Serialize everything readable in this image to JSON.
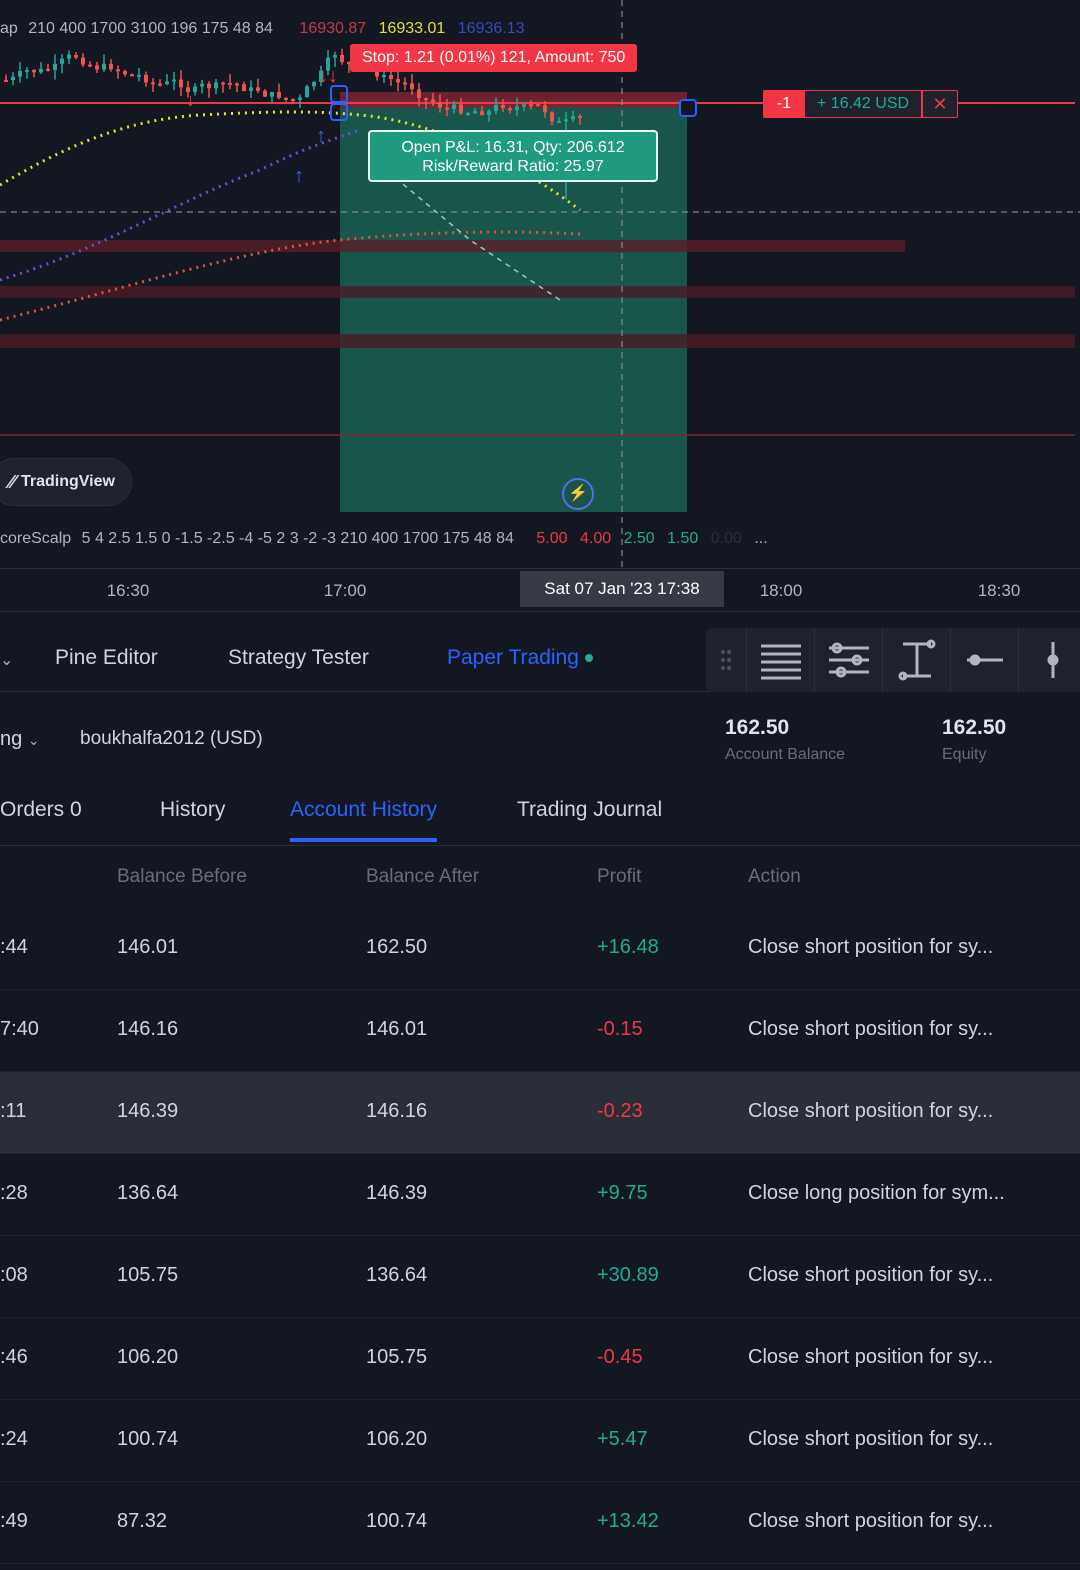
{
  "chart": {
    "top_indicator": [
      "ap",
      "210 400 1700 3100 196 175 48 84"
    ],
    "top_prices": [
      "16930.87",
      "16933.01",
      "16936.13"
    ],
    "stop_label": "Stop: 1.21 (0.01%) 121, Amount: 750",
    "pnl_line1": "Open P&L: 16.31, Qty: 206.612",
    "pnl_line2": "Risk/Reward Ratio: 25.97",
    "position": {
      "qty": "-1",
      "pnl": "+ 16.42 USD",
      "close": "✕"
    },
    "logo": "TradingView",
    "bottom_indicator_name": "coreScalp",
    "bottom_indicator_params": "5 4 2.5 1.5 0 -1.5 -2.5 -4 -5 2 3 -2 -3 210 400 1700 175 48 84",
    "bottom_values": [
      "5.00",
      "4.00",
      "2.50",
      "1.50",
      "0.00",
      "..."
    ],
    "colors": {
      "green": "#22ab94",
      "red": "#f23645",
      "blue": "#2962ff",
      "yellow": "#ffeb3b"
    }
  },
  "time_axis": {
    "ticks": [
      "16:30",
      "17:00",
      "18:00",
      "18:30"
    ],
    "crosshair": "Sat 07 Jan '23   17:38"
  },
  "panel": {
    "tabs": [
      "Pine Editor",
      "Strategy Tester",
      "Paper Trading"
    ],
    "active_tab": "Paper Trading",
    "toolbar_icons": [
      "drag-handle-icon",
      "align-lines-icon",
      "adjust-lines-icon",
      "text-cursor-icon",
      "horizontal-line-icon",
      "vertical-line-icon"
    ],
    "account_selector": "ng",
    "account_name": "boukhalfa2012 (USD)",
    "account_balance": {
      "value": "162.50",
      "label": "Account Balance"
    },
    "equity": {
      "value": "162.50",
      "label": "Equity"
    },
    "sub_tabs": [
      "Orders  0",
      "History",
      "Account History",
      "Trading Journal"
    ],
    "active_sub_tab": "Account History"
  },
  "table": {
    "headers": [
      "Balance Before",
      "Balance After",
      "Profit",
      "Action"
    ],
    "rows": [
      {
        "time": ":44",
        "before": "146.01",
        "after": "162.50",
        "profit": "+16.48",
        "action": "Close short position for sy...",
        "sign": "pos"
      },
      {
        "time": "7:40",
        "before": "146.16",
        "after": "146.01",
        "profit": "-0.15",
        "action": "Close short position for sy...",
        "sign": "neg"
      },
      {
        "time": ":11",
        "before": "146.39",
        "after": "146.16",
        "profit": "-0.23",
        "action": "Close short position for sy...",
        "sign": "neg",
        "highlight": true
      },
      {
        "time": ":28",
        "before": "136.64",
        "after": "146.39",
        "profit": "+9.75",
        "action": "Close long position for sym...",
        "sign": "pos"
      },
      {
        "time": ":08",
        "before": "105.75",
        "after": "136.64",
        "profit": "+30.89",
        "action": "Close short position for sy...",
        "sign": "pos"
      },
      {
        "time": ":46",
        "before": "106.20",
        "after": "105.75",
        "profit": "-0.45",
        "action": "Close short position for sy...",
        "sign": "neg"
      },
      {
        "time": ":24",
        "before": "100.74",
        "after": "106.20",
        "profit": "+5.47",
        "action": "Close short position for sy...",
        "sign": "pos"
      },
      {
        "time": ":49",
        "before": "87.32",
        "after": "100.74",
        "profit": "+13.42",
        "action": "Close short position for sy...",
        "sign": "pos"
      }
    ]
  }
}
